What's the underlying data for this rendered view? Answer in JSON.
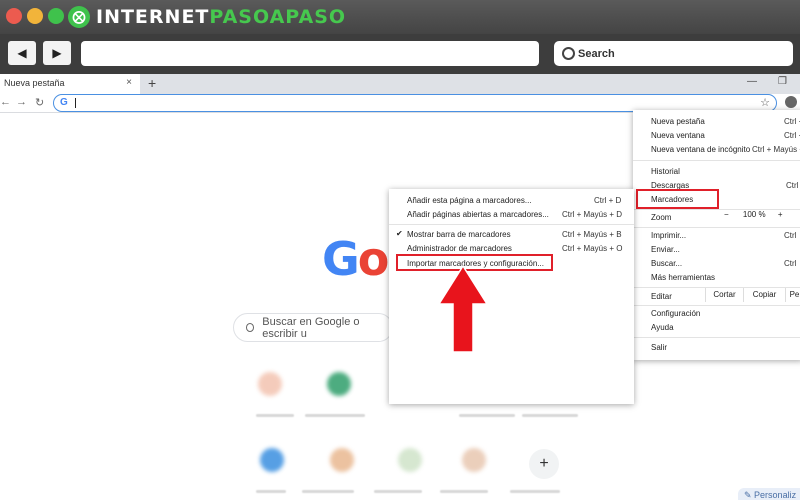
{
  "brand": {
    "logo_prefix": "INTERNET",
    "logo_accent": "PASOAPASO",
    "logo_badge": "⨂"
  },
  "outer_nav": {
    "back_icon": "◀",
    "forward_icon": "▶",
    "search_label": "Search"
  },
  "chrome": {
    "tab_title": "Nueva pestaña",
    "tab_close": "×",
    "new_tab": "+",
    "omnibox_g": "G"
  },
  "google": {
    "search_placeholder": "Buscar en Google o escribir u",
    "add_shortcut": "+",
    "personalize": "Personaliz"
  },
  "main_menu": {
    "items": [
      {
        "label": "Nueva pestaña",
        "shortcut": "Ctrl +"
      },
      {
        "label": "Nueva ventana",
        "shortcut": "Ctrl +"
      },
      {
        "label": "Nueva ventana de incógnito",
        "shortcut": "Ctrl + Mayús +"
      },
      {
        "label": "Historial",
        "shortcut": ""
      },
      {
        "label": "Descargas",
        "shortcut": "Ctrl"
      },
      {
        "label": "Marcadores",
        "shortcut": ""
      },
      {
        "label": "Zoom",
        "shortcut": ""
      },
      {
        "label": "Imprimir...",
        "shortcut": "Ctrl"
      },
      {
        "label": "Enviar...",
        "shortcut": ""
      },
      {
        "label": "Buscar...",
        "shortcut": "Ctrl"
      },
      {
        "label": "Más herramientas",
        "shortcut": ""
      },
      {
        "label": "Editar",
        "shortcut": ""
      },
      {
        "label": "Configuración",
        "shortcut": ""
      },
      {
        "label": "Ayuda",
        "shortcut": ""
      },
      {
        "label": "Salir",
        "shortcut": ""
      }
    ],
    "zoom": {
      "minus": "−",
      "value": "100 %",
      "plus": "+"
    },
    "edit": {
      "cut": "Cortar",
      "copy": "Copiar",
      "paste": "Pe"
    }
  },
  "bookmarks_menu": {
    "items": [
      {
        "label": "Añadir esta página a marcadores...",
        "shortcut": "Ctrl + D",
        "checked": false
      },
      {
        "label": "Añadir páginas abiertas a marcadores...",
        "shortcut": "Ctrl + Mayús + D",
        "checked": false
      },
      {
        "label": "Mostrar barra de marcadores",
        "shortcut": "Ctrl + Mayús + B",
        "checked": true
      },
      {
        "label": "Administrador de marcadores",
        "shortcut": "Ctrl + Mayús + O",
        "checked": false
      },
      {
        "label": "Importar marcadores y configuración...",
        "shortcut": "",
        "checked": false
      }
    ],
    "check_glyph": "✔"
  },
  "colors": {
    "highlight": "#e0202a",
    "arrow": "#e8141c",
    "brand_green": "#3fc24c",
    "omnibox_border": "#4a90e2"
  }
}
